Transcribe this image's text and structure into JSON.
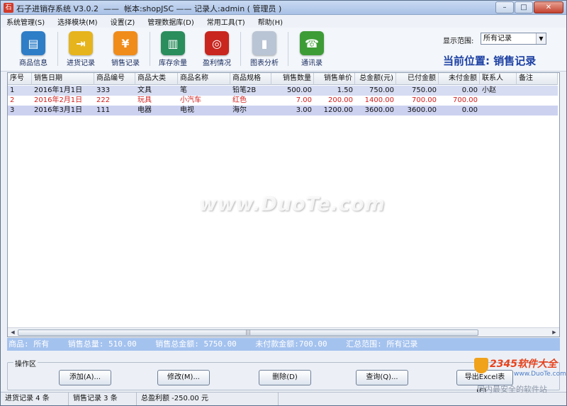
{
  "window": {
    "title": "石子进销存系统 V3.0.2  ——  帐本:shopJSC —— 记录人:admin ( 管理员 )",
    "buttons": {
      "minimize": "–",
      "maximize": "□",
      "close": "✕"
    }
  },
  "menu": [
    "系统管理(S)",
    "选择模块(M)",
    "设置(Z)",
    "管理数据库(D)",
    "常用工具(T)",
    "帮助(H)"
  ],
  "toolbar": [
    {
      "label": "商品信息",
      "icon": "document-icon",
      "color": "#2e7dc7",
      "glyph": "▤"
    },
    {
      "label": "进货记录",
      "icon": "import-icon",
      "color": "#e6b41c",
      "glyph": "⇥"
    },
    {
      "label": "销售记录",
      "icon": "yen-icon",
      "color": "#f08c1a",
      "glyph": "¥"
    },
    {
      "label": "库存余量",
      "icon": "books-icon",
      "color": "#2a8d5c",
      "glyph": "▥"
    },
    {
      "label": "盈利情况",
      "icon": "coins-icon",
      "color": "#c8261f",
      "glyph": "◎"
    },
    {
      "label": "图表分析",
      "icon": "chart-icon",
      "color": "#b9c4d4",
      "glyph": "▮"
    },
    {
      "label": "通讯录",
      "icon": "phone-icon",
      "color": "#3e9c36",
      "glyph": "☎"
    }
  ],
  "scope": {
    "label": "显示范围:",
    "value": "所有记录"
  },
  "location": "当前位置: 销售记录",
  "columns": [
    "序号",
    "销售日期",
    "商品编号",
    "商品大类",
    "商品名称",
    "商品规格",
    "销售数量",
    "销售单价",
    "总金额(元)",
    "已付金额",
    "未付金额",
    "联系人",
    "备注"
  ],
  "rows": [
    {
      "cells": [
        "1",
        "2016年1月1日",
        "333",
        "文具",
        "笔",
        "铅笔2B",
        "500.00",
        "1.50",
        "750.00",
        "750.00",
        "0.00",
        "小赵",
        ""
      ],
      "style": "selected"
    },
    {
      "cells": [
        "2",
        "2016年2月1日",
        "222",
        "玩具",
        "小汽车",
        "红色",
        "7.00",
        "200.00",
        "1400.00",
        "700.00",
        "700.00",
        "",
        ""
      ],
      "style": "unpaid"
    },
    {
      "cells": [
        "3",
        "2016年3月1日",
        "111",
        "电器",
        "电视",
        "海尔",
        "3.00",
        "1200.00",
        "3600.00",
        "3600.00",
        "0.00",
        "",
        ""
      ],
      "style": "alt"
    }
  ],
  "scrollbar_grip": "|||",
  "summary": "商品: 所有    销售总量: 510.00    销售总金额: 5750.00    未付款金额:700.00    汇总范围: 所有记录",
  "operations": {
    "group_label": "操作区",
    "add": "添加(A)...",
    "edit": "修改(M)...",
    "delete": "删除(D)",
    "query": "查询(Q)...",
    "export": "导出Excel表(E)..."
  },
  "status": [
    "进货记录 4 条",
    "销售记录 3 条",
    "总盈利额 -250.00 元"
  ],
  "watermark": "www.DuoTe.com",
  "badge": {
    "brand": "2345软件大全",
    "site": "www.DuoTe.com",
    "slogan": "国内最安全的软件站"
  },
  "colors": {
    "selected_row": "#d6dcf2",
    "unpaid_text": "#d21e1e",
    "alt_row": "#ccd1f0",
    "summary_bar": "#a4c2ee",
    "location_text": "#1b3fa3"
  }
}
